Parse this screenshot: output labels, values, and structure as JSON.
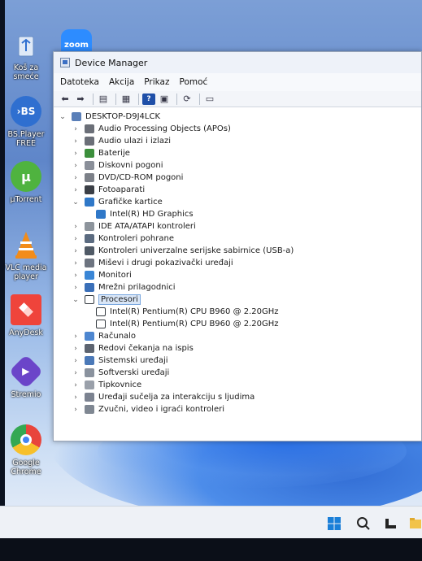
{
  "window": {
    "title": "Device Manager",
    "menu": [
      "Datoteka",
      "Akcija",
      "Prikaz",
      "Pomoć"
    ]
  },
  "desktop_icons": [
    {
      "label": "Koš za smeće",
      "icon": "recycle-bin-icon",
      "color": "#3b7fd6"
    },
    {
      "label": "zoom",
      "icon": "zoom-icon",
      "color": "#2d8cff"
    },
    {
      "label": "BS.Player FREE",
      "icon": "bsplayer-icon",
      "color": "#2f6fd0"
    },
    {
      "label": "µTorrent",
      "icon": "utorrent-icon",
      "color": "#4fb33f"
    },
    {
      "label": "VLC media player",
      "icon": "vlc-icon",
      "color": "#f28c1a"
    },
    {
      "label": "AnyDesk",
      "icon": "anydesk-icon",
      "color": "#ef443b"
    },
    {
      "label": "Stremio",
      "icon": "stremio-icon",
      "color": "#6b45c9"
    },
    {
      "label": "Google Chrome",
      "icon": "chrome-icon",
      "color": "#e8453c"
    }
  ],
  "tree": {
    "root": "DESKTOP-D9J4LCK",
    "items": [
      {
        "label": "Audio Processing Objects (APOs)",
        "expanded": false,
        "icon": "speaker-icon"
      },
      {
        "label": "Audio ulazi i izlazi",
        "expanded": false,
        "icon": "speaker-icon"
      },
      {
        "label": "Baterije",
        "expanded": false,
        "icon": "battery-icon"
      },
      {
        "label": "Diskovni pogoni",
        "expanded": false,
        "icon": "disk-icon"
      },
      {
        "label": "DVD/CD-ROM pogoni",
        "expanded": false,
        "icon": "dvd-icon"
      },
      {
        "label": "Fotoaparati",
        "expanded": false,
        "icon": "camera-icon"
      },
      {
        "label": "Grafičke kartice",
        "expanded": true,
        "icon": "display-adapter-icon"
      },
      {
        "label": "Intel(R) HD Graphics",
        "child": true,
        "icon": "display-adapter-icon"
      },
      {
        "label": "IDE ATA/ATAPI kontroleri",
        "expanded": false,
        "icon": "ide-icon"
      },
      {
        "label": "Kontroleri pohrane",
        "expanded": false,
        "icon": "storage-icon"
      },
      {
        "label": "Kontroleri univerzalne serijske sabirnice (USB-a)",
        "expanded": false,
        "icon": "usb-icon"
      },
      {
        "label": "Miševi i drugi pokazivački uređaji",
        "expanded": false,
        "icon": "mouse-icon"
      },
      {
        "label": "Monitori",
        "expanded": false,
        "icon": "monitor-icon"
      },
      {
        "label": "Mrežni prilagodnici",
        "expanded": false,
        "icon": "network-icon"
      },
      {
        "label": "Procesori",
        "expanded": true,
        "selected": true,
        "icon": "processor-icon"
      },
      {
        "label": "Intel(R) Pentium(R) CPU B960 @ 2.20GHz",
        "child": true,
        "icon": "processor-icon"
      },
      {
        "label": "Intel(R) Pentium(R) CPU B960 @ 2.20GHz",
        "child": true,
        "icon": "processor-icon"
      },
      {
        "label": "Računalo",
        "expanded": false,
        "icon": "computer-icon"
      },
      {
        "label": "Redovi čekanja na ispis",
        "expanded": false,
        "icon": "printer-icon"
      },
      {
        "label": "Sistemski uređaji",
        "expanded": false,
        "icon": "system-icon"
      },
      {
        "label": "Softverski uređaji",
        "expanded": false,
        "icon": "software-device-icon"
      },
      {
        "label": "Tipkovnice",
        "expanded": false,
        "icon": "keyboard-icon"
      },
      {
        "label": "Uređaji sučelja za interakciju s ljudima",
        "expanded": false,
        "icon": "hid-icon"
      },
      {
        "label": "Zvučni, video i igraći kontroleri",
        "expanded": false,
        "icon": "sound-icon"
      }
    ]
  },
  "taskbar": {
    "icons": [
      "windows-start-icon",
      "search-icon",
      "task-view-icon",
      "folder-icon"
    ]
  }
}
